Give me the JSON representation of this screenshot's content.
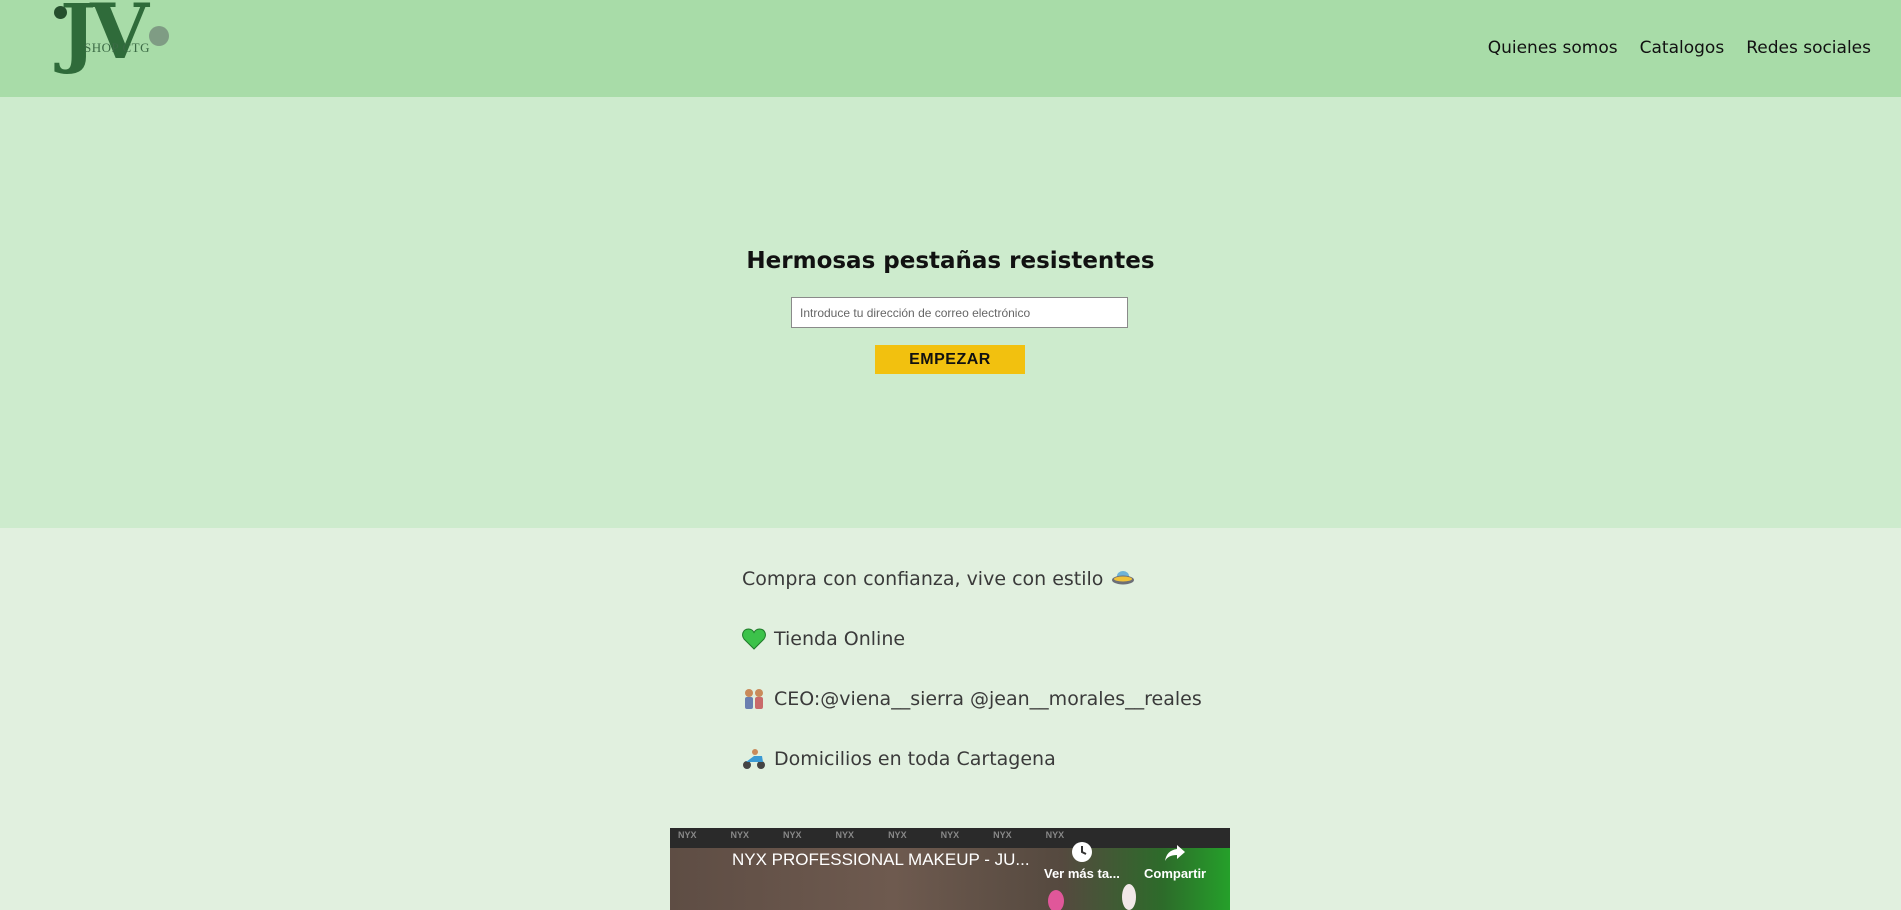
{
  "header": {
    "logo": {
      "letters": "JV",
      "subtitle": "SHOP CTG"
    },
    "nav": [
      {
        "label": "Quienes somos"
      },
      {
        "label": "Catalogos"
      },
      {
        "label": "Redes sociales"
      }
    ]
  },
  "hero": {
    "title": "Hermosas pestañas resistentes",
    "email_placeholder": "Introduce tu dirección de correo electrónico",
    "email_value": "",
    "cta_label": "EMPEZAR"
  },
  "info": {
    "lines": [
      {
        "text": "Compra con confianza, vive con estilo",
        "icon": "ufo-emoji-icon"
      },
      {
        "text": "Tienda Online",
        "icon": "green-heart-emoji-icon"
      },
      {
        "text": "CEO:@viena__sierra @jean__morales__reales",
        "icon": "couple-emoji-icon"
      },
      {
        "text": "Domicilios en toda Cartagena",
        "icon": "scooter-emoji-icon"
      }
    ]
  },
  "video": {
    "title": "NYX PROFESSIONAL MAKEUP - JU...",
    "watch_later_label": "Ver más ta...",
    "share_label": "Compartir",
    "watermark": "NYX"
  },
  "colors": {
    "header_bg": "#a8dca8",
    "hero_bg": "#cdebcd",
    "page_bg": "#e1f0df",
    "cta_bg": "#f2c10f"
  }
}
